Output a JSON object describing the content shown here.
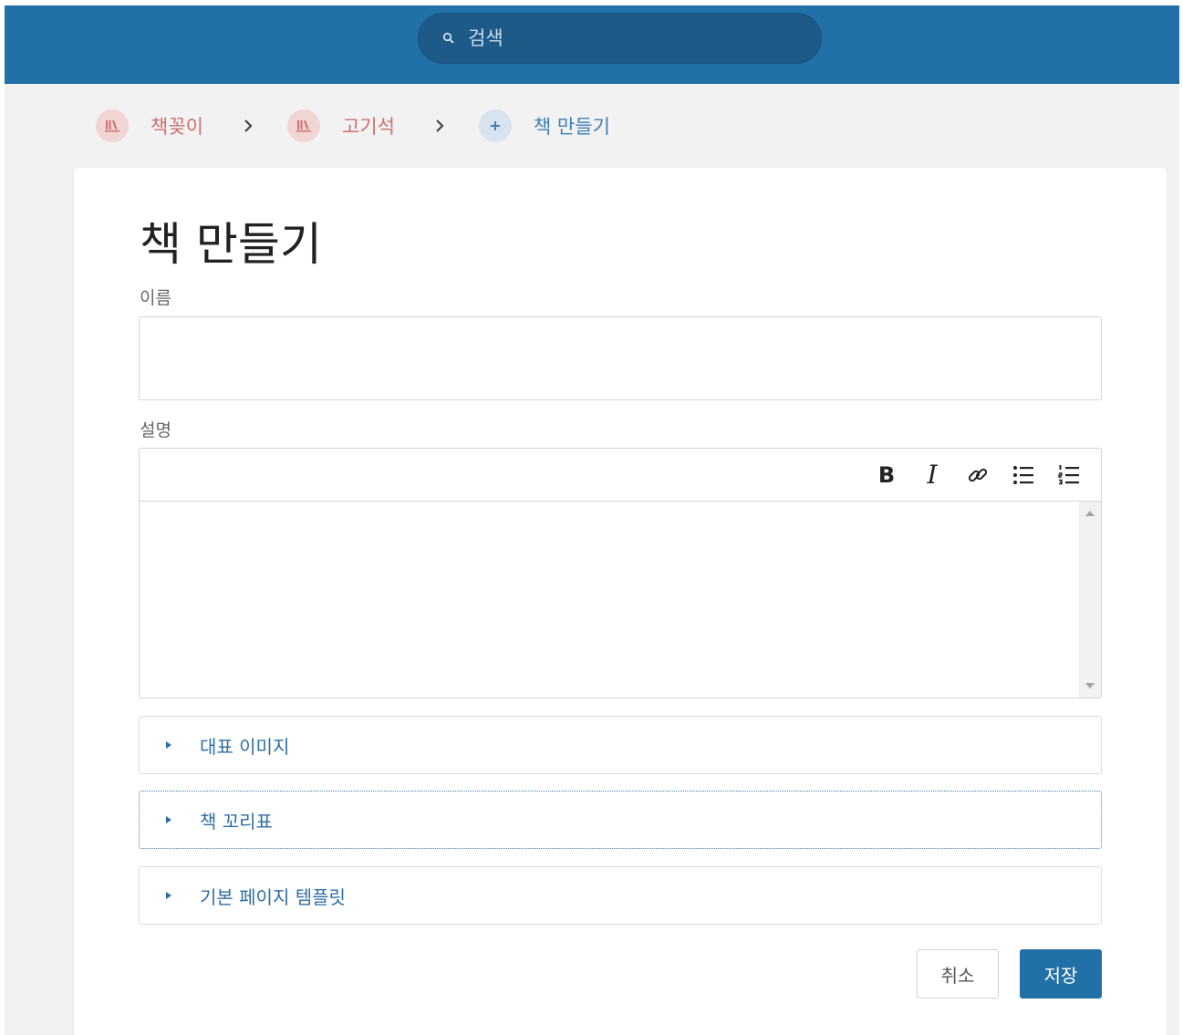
{
  "search": {
    "placeholder": "검색"
  },
  "breadcrumb": {
    "items": [
      {
        "label": "책꽂이",
        "icon": "bookshelf-icon",
        "color": "#cf6f6f"
      },
      {
        "label": "고기석",
        "icon": "bookshelf-icon",
        "color": "#cf6f6f"
      },
      {
        "label": "책 만들기",
        "icon": "plus-icon",
        "color": "#3e7fb5"
      }
    ]
  },
  "form": {
    "title": "책 만들기",
    "name_label": "이름",
    "name_value": "",
    "description_label": "설명",
    "toolbar": [
      "bold-icon",
      "italic-icon",
      "link-icon",
      "bullet-list-icon",
      "numbered-list-icon"
    ],
    "sections": [
      {
        "label": "대표 이미지"
      },
      {
        "label": "책 꼬리표"
      },
      {
        "label": "기본 페이지 템플릿"
      }
    ],
    "cancel_label": "취소",
    "save_label": "저장"
  },
  "colors": {
    "brand": "#2270a8",
    "shelf": "#cf6f6f",
    "link": "#3e7fb5"
  }
}
